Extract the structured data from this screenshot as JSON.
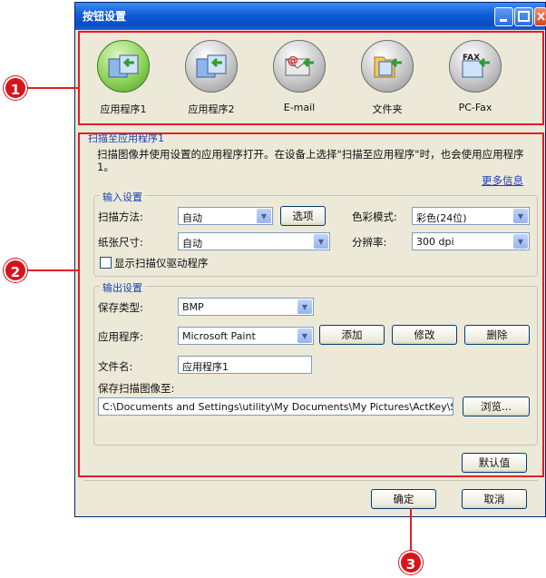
{
  "window": {
    "title": "按钮设置"
  },
  "iconbar": {
    "items": [
      {
        "label": "应用程序1",
        "icon": "app-icon",
        "active": true
      },
      {
        "label": "应用程序2",
        "icon": "app-icon"
      },
      {
        "label": "E-mail",
        "icon": "email-icon"
      },
      {
        "label": "文件夹",
        "icon": "folder-icon"
      },
      {
        "label": "PC-Fax",
        "icon": "fax-icon",
        "badge": "FAX"
      }
    ]
  },
  "panel": {
    "title": "扫描至应用程序1",
    "description": "扫描图像并使用设置的应用程序打开。在设备上选择\"扫描至应用程序\"时，也会使用应用程序1。",
    "more_info": "更多信息"
  },
  "input_settings": {
    "title": "输入设置",
    "scan_method_label": "扫描方法:",
    "scan_method_value": "自动",
    "options_button": "选项",
    "color_mode_label": "色彩模式:",
    "color_mode_value": "彩色(24位)",
    "paper_size_label": "纸张尺寸:",
    "paper_size_value": "自动",
    "resolution_label": "分辨率:",
    "resolution_value": "300 dpi",
    "show_driver_label": "显示扫描仪驱动程序",
    "show_driver_checked": false
  },
  "output_settings": {
    "title": "输出设置",
    "save_type_label": "保存类型:",
    "save_type_value": "BMP",
    "app_label": "应用程序:",
    "app_value": "Microsoft Paint",
    "add_button": "添加",
    "modify_button": "修改",
    "delete_button": "删除",
    "filename_label": "文件名:",
    "filename_value": "应用程序1",
    "save_to_label": "保存扫描图像至:",
    "save_to_value": "C:\\Documents and Settings\\utility\\My Documents\\My Pictures\\ActKey\\ScanToAp",
    "browse_button": "浏览..."
  },
  "footer": {
    "default_button": "默认值",
    "ok_button": "确定",
    "cancel_button": "取消"
  },
  "callouts": [
    "1",
    "2",
    "3"
  ],
  "colors": {
    "annotation": "#e31e24",
    "title_bar": "#0a4dc4",
    "dialog_bg": "#ece9d8"
  }
}
